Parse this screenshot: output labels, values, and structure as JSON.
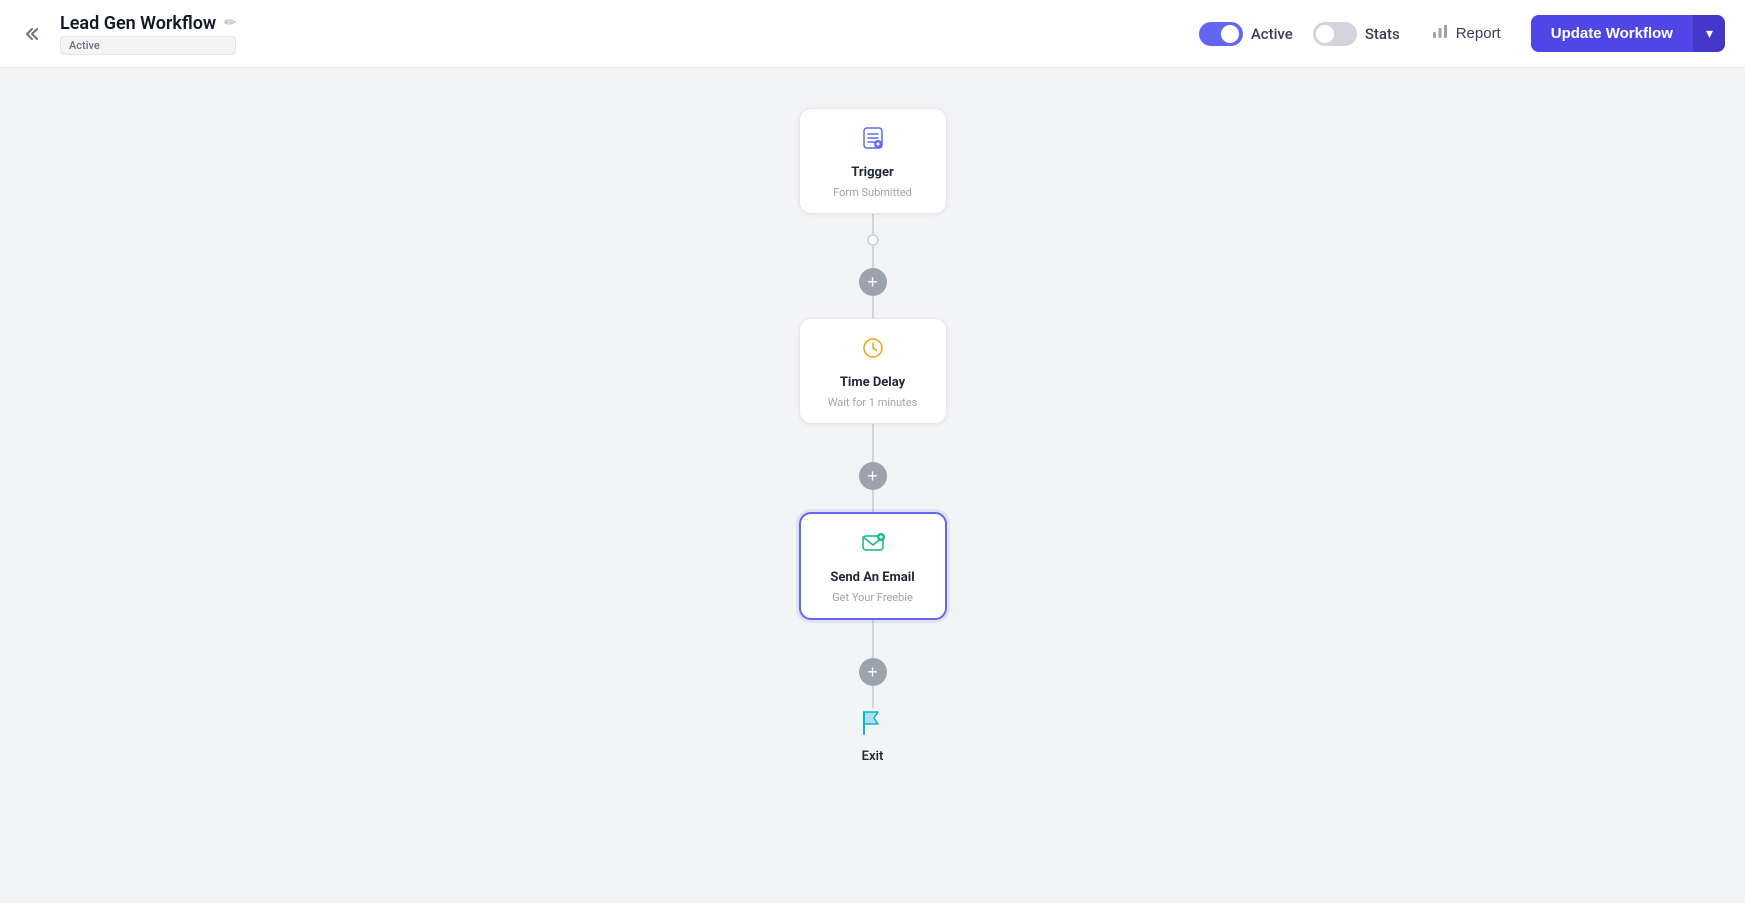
{
  "header": {
    "back_label": "<<",
    "workflow_title": "Lead Gen Workflow",
    "active_badge": "Active",
    "edit_icon": "✏",
    "active_toggle_label": "Active",
    "active_toggle_on": true,
    "stats_toggle_label": "Stats",
    "stats_toggle_on": false,
    "report_label": "Report",
    "update_btn_label": "Update Workflow",
    "update_btn_arrow": "▾"
  },
  "workflow": {
    "nodes": [
      {
        "id": "trigger",
        "type": "trigger",
        "title": "Trigger",
        "subtitle": "Form Submitted",
        "icon": "📋",
        "selected": false
      },
      {
        "id": "time-delay",
        "type": "delay",
        "title": "Time Delay",
        "subtitle": "Wait for 1 minutes",
        "icon": "⏱",
        "selected": false
      },
      {
        "id": "send-email",
        "type": "email",
        "title": "Send An Email",
        "subtitle": "Get Your Freebie",
        "icon": "✉",
        "selected": true
      }
    ],
    "exit_label": "Exit"
  }
}
